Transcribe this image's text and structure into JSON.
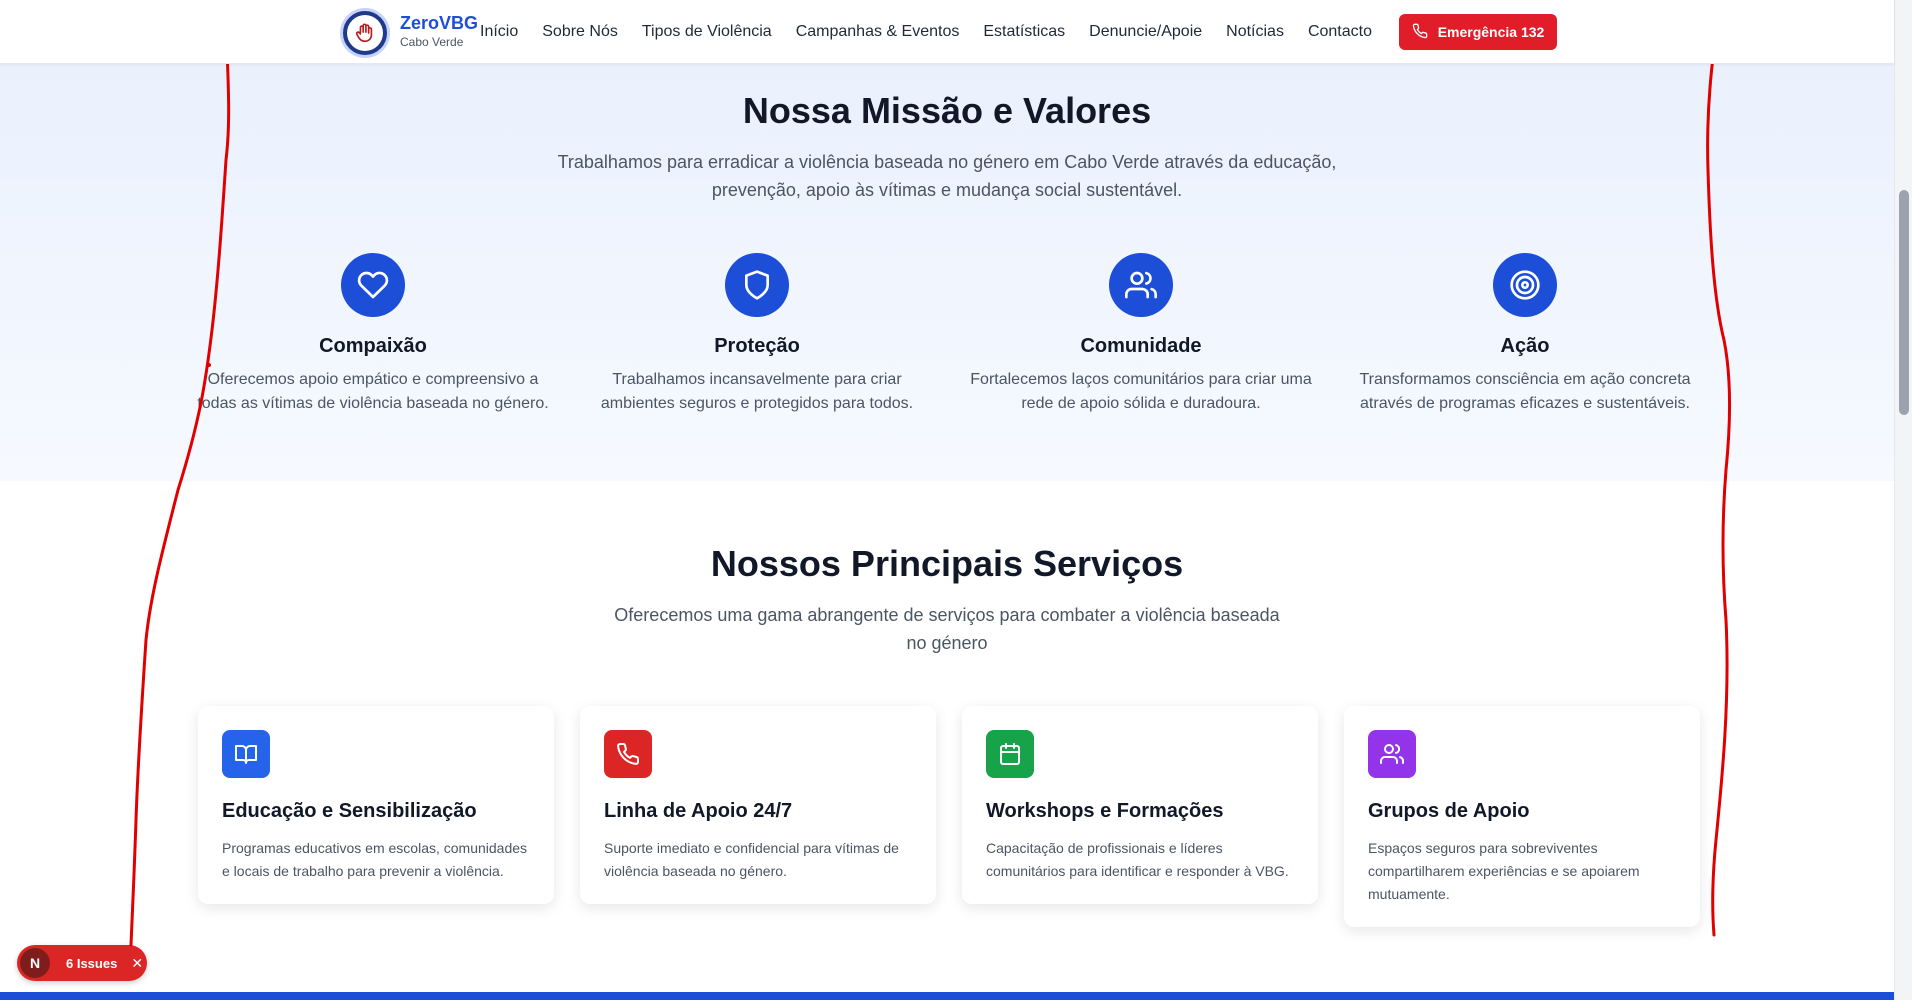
{
  "header": {
    "brand_name": "ZeroVBG",
    "brand_sub": "Cabo Verde",
    "nav": [
      "Início",
      "Sobre Nós",
      "Tipos de Violência",
      "Campanhas & Eventos",
      "Estatísticas",
      "Denuncie/Apoie",
      "Notícias",
      "Contacto"
    ],
    "emergency_label": "Emergência 132"
  },
  "mission": {
    "title": "Nossa Missão e Valores",
    "lead": "Trabalhamos para erradicar a violência baseada no género em Cabo Verde através da educação, prevenção, apoio às vítimas e mudança social sustentável.",
    "values": [
      {
        "icon": "heart-icon",
        "title": "Compaixão",
        "text": "Oferecemos apoio empático e compreensivo a todas as vítimas de violência baseada no género."
      },
      {
        "icon": "shield-icon",
        "title": "Proteção",
        "text": "Trabalhamos incansavelmente para criar ambientes seguros e protegidos para todos."
      },
      {
        "icon": "users-icon",
        "title": "Comunidade",
        "text": "Fortalecemos laços comunitários para criar uma rede de apoio sólida e duradoura."
      },
      {
        "icon": "target-icon",
        "title": "Ação",
        "text": "Transformamos consciência em ação concreta através de programas eficazes e sustentáveis."
      }
    ]
  },
  "services": {
    "title": "Nossos Principais Serviços",
    "lead": "Oferecemos uma gama abrangente de serviços para combater a violência baseada no género",
    "items": [
      {
        "icon": "book-icon",
        "color": "#2563eb",
        "title": "Educação e Sensibilização",
        "text": "Programas educativos em escolas, comunidades e locais de trabalho para prevenir a violência."
      },
      {
        "icon": "phone-icon",
        "color": "#dc2626",
        "title": "Linha de Apoio 24/7",
        "text": "Suporte imediato e confidencial para vítimas de violência baseada no género."
      },
      {
        "icon": "calendar-icon",
        "color": "#16a34a",
        "title": "Workshops e Formações",
        "text": "Capacitação de profissionais e líderes comunitários para identificar e responder à VBG."
      },
      {
        "icon": "users-icon",
        "color": "#9333ea",
        "title": "Grupos de Apoio",
        "text": "Espaços seguros para sobreviventes compartilharem experiências e se apoiarem mutuamente."
      }
    ]
  },
  "dev_overlay": {
    "avatar_letter": "N",
    "issues_label": "6 Issues",
    "close_glyph": "✕"
  },
  "colors": {
    "primary": "#1d4ed8",
    "emergency": "#e11d2a",
    "annotation": "#e00000"
  }
}
